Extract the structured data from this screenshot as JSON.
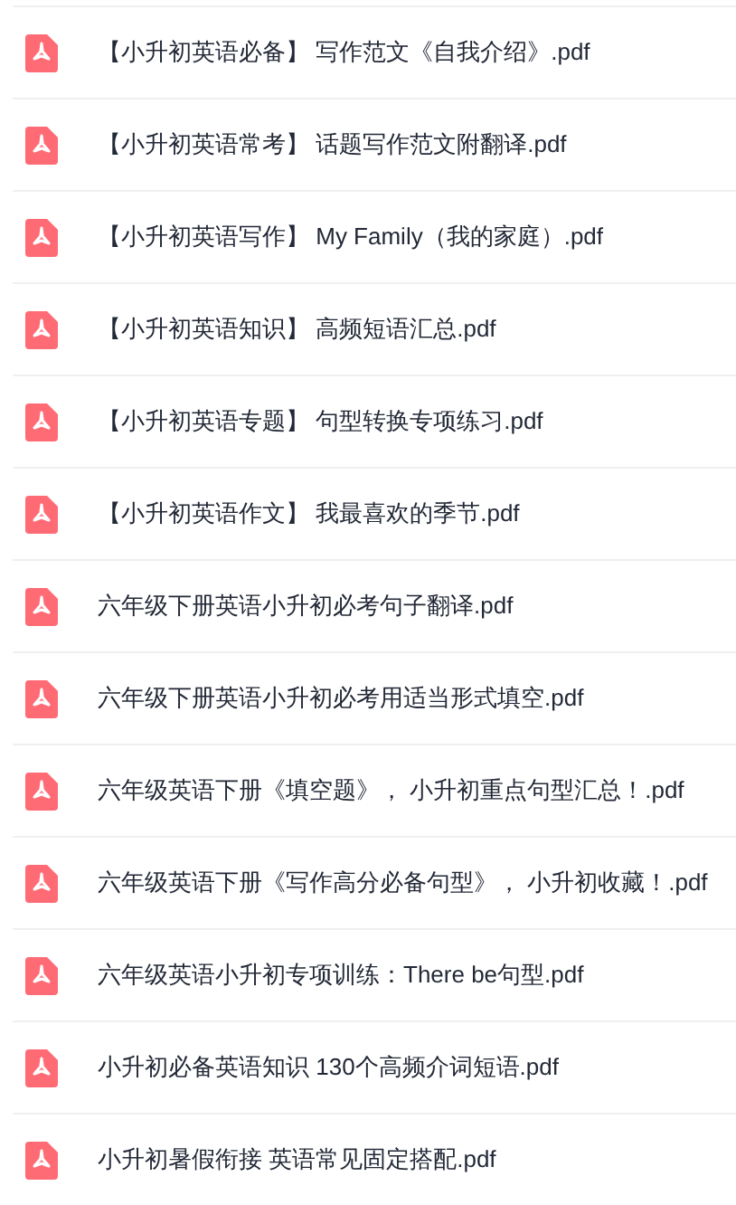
{
  "files": [
    {
      "name": "【小升初英语必备】 写作范文《自我介绍》.pdf"
    },
    {
      "name": "【小升初英语常考】 话题写作范文附翻译.pdf"
    },
    {
      "name": "【小升初英语写作】 My Family（我的家庭）.pdf"
    },
    {
      "name": "【小升初英语知识】 高频短语汇总.pdf"
    },
    {
      "name": "【小升初英语专题】 句型转换专项练习.pdf"
    },
    {
      "name": "【小升初英语作文】 我最喜欢的季节.pdf"
    },
    {
      "name": "六年级下册英语小升初必考句子翻译.pdf"
    },
    {
      "name": "六年级下册英语小升初必考用适当形式填空.pdf"
    },
    {
      "name": "六年级英语下册《填空题》， 小升初重点句型汇总！.pdf"
    },
    {
      "name": "六年级英语下册《写作高分必备句型》， 小升初收藏！.pdf"
    },
    {
      "name": "六年级英语小升初专项训练：There be句型.pdf"
    },
    {
      "name": "小升初必备英语知识 130个高频介词短语.pdf"
    },
    {
      "name": "小升初暑假衔接 英语常见固定搭配.pdf"
    }
  ]
}
